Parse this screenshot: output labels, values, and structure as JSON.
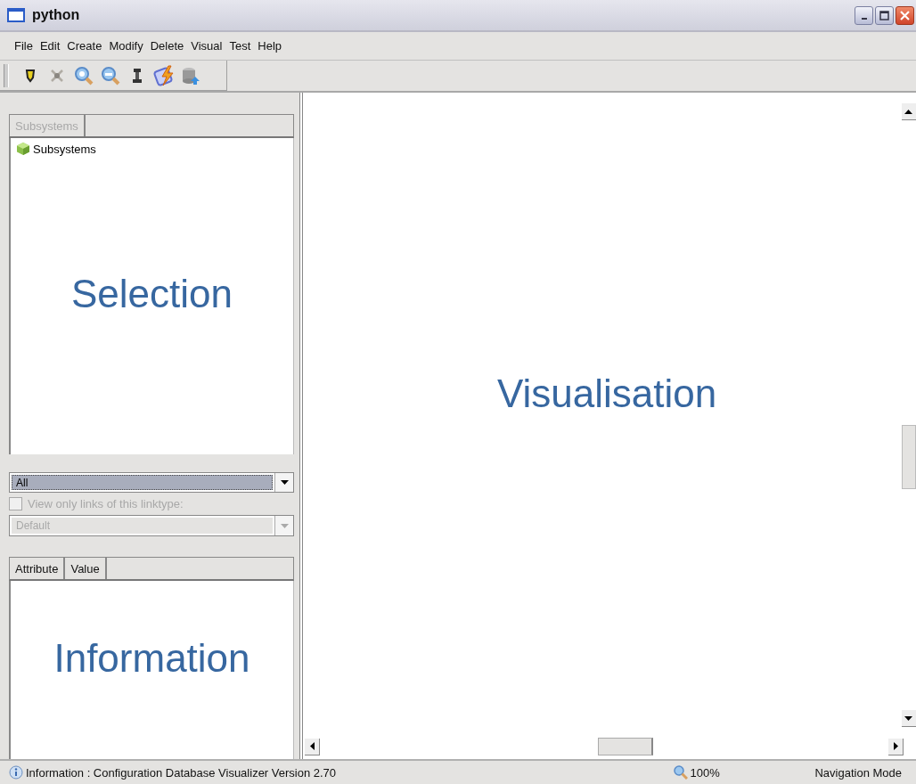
{
  "window": {
    "title": "python"
  },
  "menu": [
    {
      "label": "File"
    },
    {
      "label": "Edit"
    },
    {
      "label": "Create"
    },
    {
      "label": "Modify"
    },
    {
      "label": "Delete"
    },
    {
      "label": "Visual"
    },
    {
      "label": "Test"
    },
    {
      "label": "Help"
    }
  ],
  "selection_panel": {
    "tree_columns": [
      {
        "label": "Subsystems",
        "disabled": true
      }
    ],
    "tree_items": [
      {
        "label": "Subsystems"
      }
    ],
    "annotation": "Selection"
  },
  "filter": {
    "combo_value": "All",
    "link_checkbox": {
      "label": "View only links of this linktype:",
      "checked": false,
      "disabled": true
    },
    "linktype_combo": {
      "value": "Default",
      "disabled": true
    }
  },
  "information_panel": {
    "columns": [
      {
        "label": "Attribute"
      },
      {
        "label": "Value"
      }
    ],
    "annotation": "Information"
  },
  "visualisation": {
    "annotation": "Visualisation"
  },
  "status_bar": {
    "message": "Information : Configuration Database Visualizer Version 2.70",
    "zoom": "100%",
    "mode": "Navigation Mode"
  }
}
